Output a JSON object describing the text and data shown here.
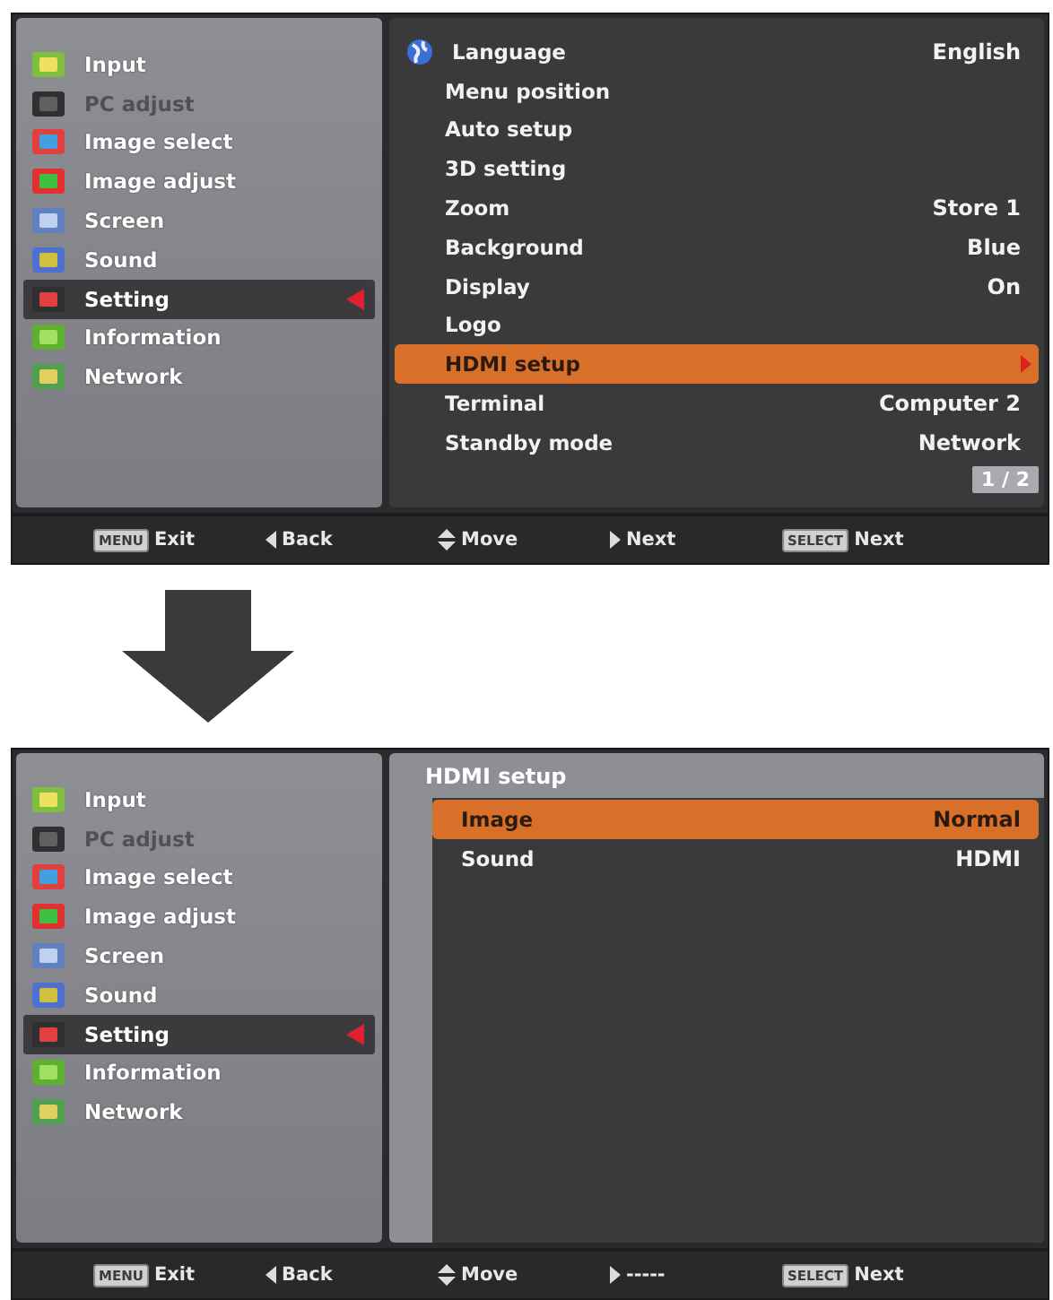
{
  "screens": [
    {
      "sidebar": [
        {
          "label": "Input",
          "disabled": false,
          "selected": false
        },
        {
          "label": "PC adjust",
          "disabled": true,
          "selected": false
        },
        {
          "label": "Image select",
          "disabled": false,
          "selected": false
        },
        {
          "label": "Image adjust",
          "disabled": false,
          "selected": false
        },
        {
          "label": "Screen",
          "disabled": false,
          "selected": false
        },
        {
          "label": "Sound",
          "disabled": false,
          "selected": false
        },
        {
          "label": "Setting",
          "disabled": false,
          "selected": true
        },
        {
          "label": "Information",
          "disabled": false,
          "selected": false
        },
        {
          "label": "Network",
          "disabled": false,
          "selected": false
        }
      ],
      "panel": {
        "kind": "main",
        "items": [
          {
            "label": "Language",
            "value": "English",
            "selected": false,
            "arrow": false
          },
          {
            "label": "Menu position",
            "selected": false,
            "arrow": false
          },
          {
            "label": "Auto setup",
            "selected": false,
            "arrow": false
          },
          {
            "label": "3D setting",
            "selected": false,
            "arrow": false
          },
          {
            "label": "Zoom",
            "value": "Store 1",
            "selected": false,
            "arrow": false
          },
          {
            "label": "Background",
            "value": "Blue",
            "selected": false,
            "arrow": false
          },
          {
            "label": "Display",
            "value": "On",
            "selected": false,
            "arrow": false
          },
          {
            "label": "Logo",
            "selected": false,
            "arrow": false
          },
          {
            "label": "HDMI setup",
            "selected": true,
            "arrow": true
          },
          {
            "label": "Terminal",
            "value": "Computer 2",
            "selected": false,
            "arrow": false
          },
          {
            "label": "Standby mode",
            "value": "Network",
            "selected": false,
            "arrow": false
          }
        ],
        "page": "1 / 2"
      },
      "footer": [
        {
          "kind": "key",
          "key": "MENU",
          "label": "Exit"
        },
        {
          "kind": "left",
          "label": "Back"
        },
        {
          "kind": "updown",
          "label": "Move"
        },
        {
          "kind": "right",
          "label": "Next"
        },
        {
          "kind": "key",
          "key": "SELECT",
          "label": "Next"
        }
      ]
    },
    {
      "sidebar": [
        {
          "label": "Input",
          "disabled": false,
          "selected": false
        },
        {
          "label": "PC adjust",
          "disabled": true,
          "selected": false
        },
        {
          "label": "Image select",
          "disabled": false,
          "selected": false
        },
        {
          "label": "Image adjust",
          "disabled": false,
          "selected": false
        },
        {
          "label": "Screen",
          "disabled": false,
          "selected": false
        },
        {
          "label": "Sound",
          "disabled": false,
          "selected": false
        },
        {
          "label": "Setting",
          "disabled": false,
          "selected": true
        },
        {
          "label": "Information",
          "disabled": false,
          "selected": false
        },
        {
          "label": "Network",
          "disabled": false,
          "selected": false
        }
      ],
      "panel": {
        "kind": "submenu",
        "title": "HDMI setup",
        "items": [
          {
            "label": "Image",
            "value": "Normal",
            "selected": true,
            "arrow": false
          },
          {
            "label": "Sound",
            "value": "HDMI",
            "selected": false,
            "arrow": false
          }
        ]
      },
      "footer": [
        {
          "kind": "key",
          "key": "MENU",
          "label": "Exit"
        },
        {
          "kind": "left",
          "label": "Back"
        },
        {
          "kind": "updown",
          "label": "Move"
        },
        {
          "kind": "right",
          "label": "-----"
        },
        {
          "kind": "key",
          "key": "SELECT",
          "label": "Next"
        }
      ]
    }
  ]
}
